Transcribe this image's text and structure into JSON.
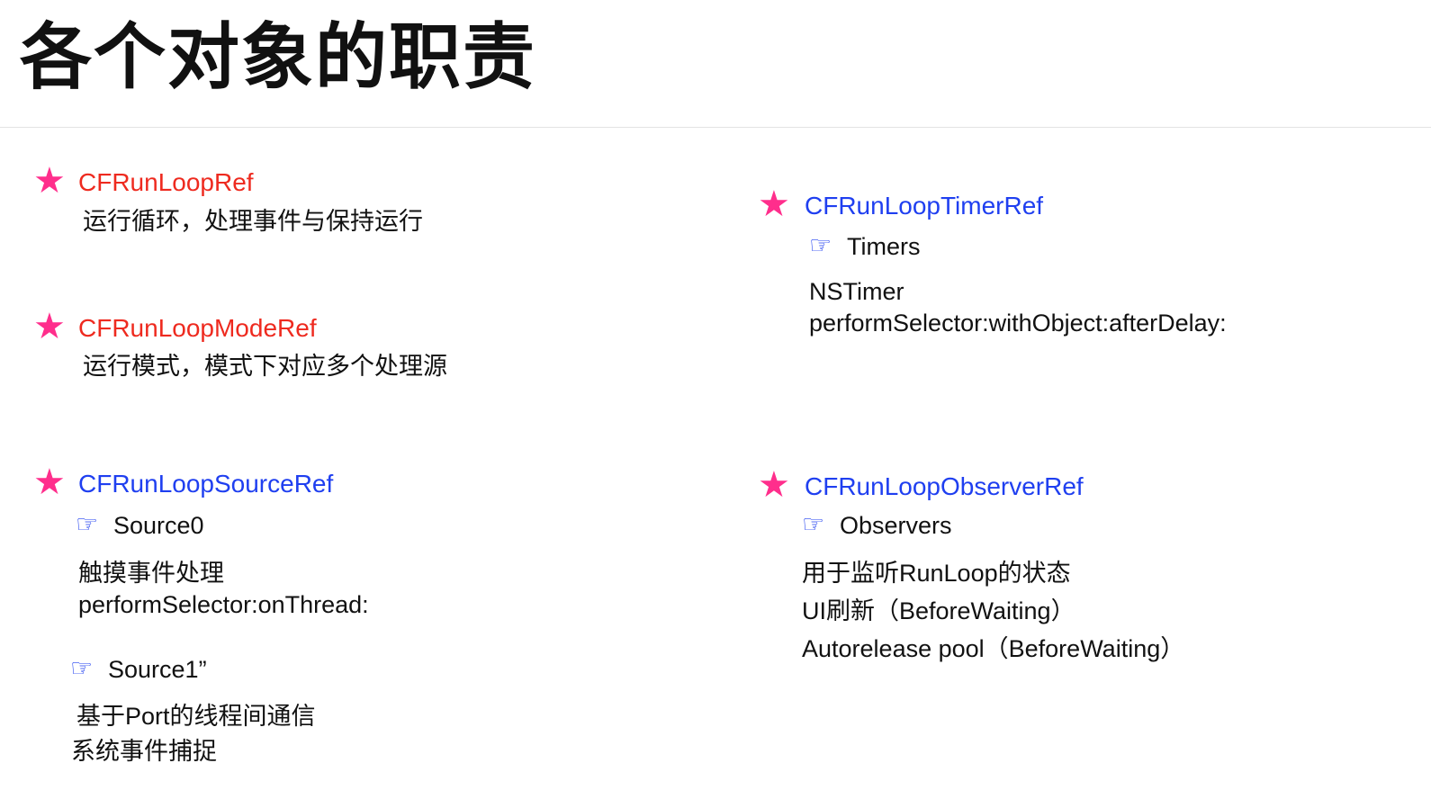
{
  "title": "各个对象的职责",
  "colors": {
    "star": "#ff2e8c",
    "red_ref": "#ee2a1f",
    "blue_ref": "#1f3ff0",
    "text": "#111111"
  },
  "icons": {
    "star": "★",
    "pointing_hand": "☞"
  },
  "items": {
    "runloop": {
      "name": "CFRunLoopRef",
      "desc": "运行循环，处理事件与保持运行"
    },
    "mode": {
      "name": "CFRunLoopModeRef",
      "desc": "运行模式，模式下对应多个处理源"
    },
    "source": {
      "name": "CFRunLoopSourceRef",
      "source0": {
        "label": "Source0",
        "lines": [
          "触摸事件处理",
          "performSelector:onThread:"
        ]
      },
      "source1": {
        "label": "Source1”",
        "lines": [
          "基于Port的线程间通信",
          "系统事件捕捉"
        ]
      }
    },
    "timer": {
      "name": "CFRunLoopTimerRef",
      "label": "Timers",
      "lines": [
        "NSTimer",
        "performSelector:withObject:afterDelay:"
      ]
    },
    "observer": {
      "name": "CFRunLoopObserverRef",
      "label": "Observers",
      "lines": [
        "用于监听RunLoop的状态",
        "UI刷新（BeforeWaiting）",
        "Autorelease pool（BeforeWaiting）"
      ]
    }
  }
}
